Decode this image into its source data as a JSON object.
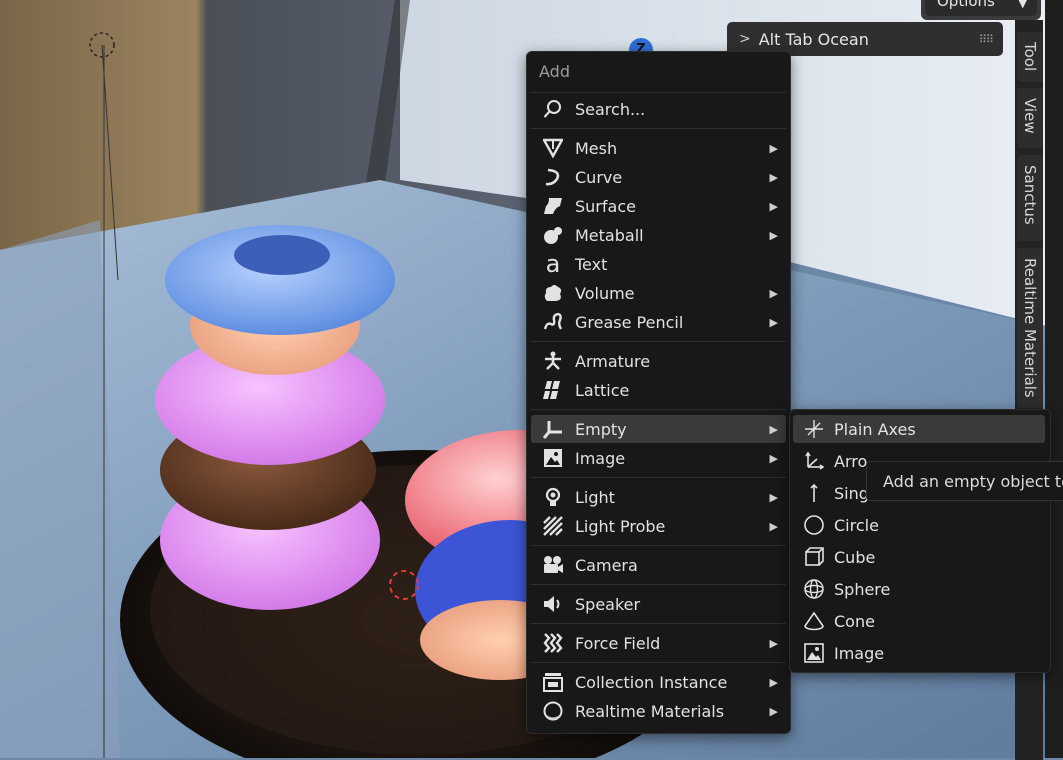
{
  "header": {
    "options_label": "Options",
    "panel_title": "Alt Tab Ocean",
    "gizmo_z": "Z"
  },
  "side_tabs": [
    "Tool",
    "View",
    "Sanctus",
    "Realtime Materials"
  ],
  "menu": {
    "title": "Add",
    "search_label": "Search...",
    "items": [
      {
        "label": "Mesh",
        "icon": "mesh-icon",
        "submenu": true
      },
      {
        "label": "Curve",
        "icon": "curve-icon",
        "submenu": true
      },
      {
        "label": "Surface",
        "icon": "surface-icon",
        "submenu": true
      },
      {
        "label": "Metaball",
        "icon": "metaball-icon",
        "submenu": true
      },
      {
        "label": "Text",
        "icon": "text-icon",
        "submenu": false
      },
      {
        "label": "Volume",
        "icon": "volume-icon",
        "submenu": true
      },
      {
        "label": "Grease Pencil",
        "icon": "grease-pencil-icon",
        "submenu": true
      },
      {
        "label": "Armature",
        "icon": "armature-icon",
        "submenu": false
      },
      {
        "label": "Lattice",
        "icon": "lattice-icon",
        "submenu": false
      },
      {
        "label": "Empty",
        "icon": "empty-icon",
        "submenu": true,
        "active": true
      },
      {
        "label": "Image",
        "icon": "image-icon",
        "submenu": true
      },
      {
        "label": "Light",
        "icon": "light-icon",
        "submenu": true
      },
      {
        "label": "Light Probe",
        "icon": "light-probe-icon",
        "submenu": true
      },
      {
        "label": "Camera",
        "icon": "camera-icon",
        "submenu": false
      },
      {
        "label": "Speaker",
        "icon": "speaker-icon",
        "submenu": false
      },
      {
        "label": "Force Field",
        "icon": "force-field-icon",
        "submenu": true
      },
      {
        "label": "Collection Instance",
        "icon": "collection-instance-icon",
        "submenu": true
      },
      {
        "label": "Realtime Materials",
        "icon": "realtime-materials-icon",
        "submenu": true
      }
    ]
  },
  "empty_submenu": {
    "items": [
      {
        "label": "Plain Axes",
        "icon": "plain-axes-icon",
        "active": true
      },
      {
        "label": "Arro",
        "icon": "arrows-icon"
      },
      {
        "label": "Sing",
        "icon": "single-arrow-icon"
      },
      {
        "label": "Circle",
        "icon": "circle-icon"
      },
      {
        "label": "Cube",
        "icon": "cube-icon"
      },
      {
        "label": "Sphere",
        "icon": "sphere-icon"
      },
      {
        "label": "Cone",
        "icon": "cone-icon"
      },
      {
        "label": "Image",
        "icon": "image-icon"
      }
    ]
  },
  "tooltip": {
    "text": "Add an empty object to"
  },
  "colors": {
    "menu_bg": "#181818",
    "highlight": "#3a3a3a",
    "text": "#e2e2e2",
    "gizmo_blue": "#2d6fd6"
  }
}
